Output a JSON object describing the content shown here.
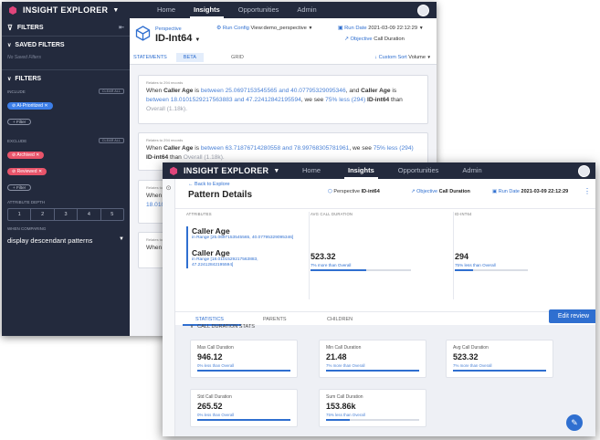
{
  "app": {
    "name": "INSIGHT EXPLORER"
  },
  "nav": {
    "home": "Home",
    "insights": "Insights",
    "opportunities": "Opportunities",
    "admin": "Admin"
  },
  "colors": {
    "dark": "#232a3d",
    "accent": "#2f6fd0",
    "brand": "#e0457b",
    "chip_blue": "#3c7ee8",
    "chip_red": "#e8546a"
  },
  "sidebar": {
    "filters_title": "FILTERS",
    "saved_title": "SAVED FILTERS",
    "no_saved": "No Saved Filters",
    "filters_section": "FILTERS",
    "include_label": "INCLUDE",
    "clear_all": "CLEAR ALL",
    "include_chip": "AI-Prioritized",
    "add_filter": "+ Filter",
    "exclude_label": "EXCLUDE",
    "exclude_chips": [
      "Archived",
      "Reviewed"
    ],
    "depth_label": "ATTRIBUTE DEPTH",
    "depth_options": [
      "1",
      "2",
      "3",
      "4",
      "5"
    ],
    "compare_label": "WHEN COMPARING",
    "compare_value": "display descendant patterns"
  },
  "header1": {
    "perspective_label": "Perspective",
    "perspective_value": "ID-Int64",
    "run_config_label": "Run Config",
    "run_config_value": "View:demo_perspective",
    "run_date_label": "Run Date",
    "run_date_value": "2021-03-09 22:12:29",
    "objective_label": "Objective",
    "objective_value": "Call Duration",
    "tabs": [
      "STATEMENTS",
      "BETA",
      "GRID"
    ],
    "sort_label": "Custom Sort",
    "sort_value": "Volume"
  },
  "cards": [
    {
      "records": "Relates to 294 records",
      "t1": "When ",
      "a1": "Caller Age",
      "t2": " is ",
      "r1": "between 25.0697153545565 and 40.07795329095346",
      "t3": ", and ",
      "a2": "Caller Age",
      "t4": " is ",
      "r2": "between 18.0101529217563883 and 47.22412842195594",
      "t5": ", we see ",
      "pct": "75% less (294)",
      "t6": " ",
      "metric": "ID-int64",
      "t7": " than ",
      "overall": "Overall (1.18k)."
    },
    {
      "records": "Relates to 294 records",
      "t1": "When ",
      "a1": "Caller Age",
      "t2": " is ",
      "r1": "between 63.71876714280558 and 78.99768305781961",
      "t3": ", we see ",
      "pct": "75% less (294)",
      "t4": " ",
      "metric": "ID-int64",
      "t5": " than ",
      "overall": "Overall (1.18k)."
    },
    {
      "records": "Relates to",
      "frag1": "When",
      "frag2": "18.0101"
    },
    {
      "records": "Relates to",
      "frag1": "When"
    }
  ],
  "details": {
    "back": "Back to Explore",
    "title": "Pattern Details",
    "perspective_label": "Perspective",
    "perspective_value": "ID-int64",
    "objective_label": "Objective",
    "objective_value": "Call Duration",
    "run_date_label": "Run Date",
    "run_date_value": "2021-03-09 22:12:29",
    "col_attributes": "ATTRIBUTES",
    "col_avg": "AVG CALL DURATION",
    "col_id": "ID-INT64",
    "attr1_name": "Caller Age",
    "attr1_range": "in Range [25.0697153545565, 40.07795329095346]",
    "attr2_name": "Caller Age",
    "attr2_range": "in Range [18.0101529217563883, 47.22412842195594]",
    "avg_value": "523.32",
    "avg_change": "7% more than Overall",
    "avg_fill": 0.55,
    "id_value": "294",
    "id_change": "75% less than Overall",
    "id_fill": 0.25,
    "tabs": [
      "STATISTICS",
      "PARENTS",
      "CHILDREN"
    ],
    "edit_review": "Edit review",
    "stats_title": "CALL DURATION STATS",
    "stats": [
      {
        "name": "Max Call Duration",
        "value": "946.12",
        "change": "0% less than Overall",
        "fill": 1.0
      },
      {
        "name": "Min Call Duration",
        "value": "21.48",
        "change": "7% more than Overall",
        "fill": 1.0
      },
      {
        "name": "Avg Call Duration",
        "value": "523.32",
        "change": "7% more than Overall",
        "fill": 1.0
      },
      {
        "name": "Std Call Duration",
        "value": "265.52",
        "change": "0% less than Overall",
        "fill": 1.0
      },
      {
        "name": "Sum Call Duration",
        "value": "153.86k",
        "change": "75% less than Overall",
        "fill": 0.25
      }
    ]
  }
}
